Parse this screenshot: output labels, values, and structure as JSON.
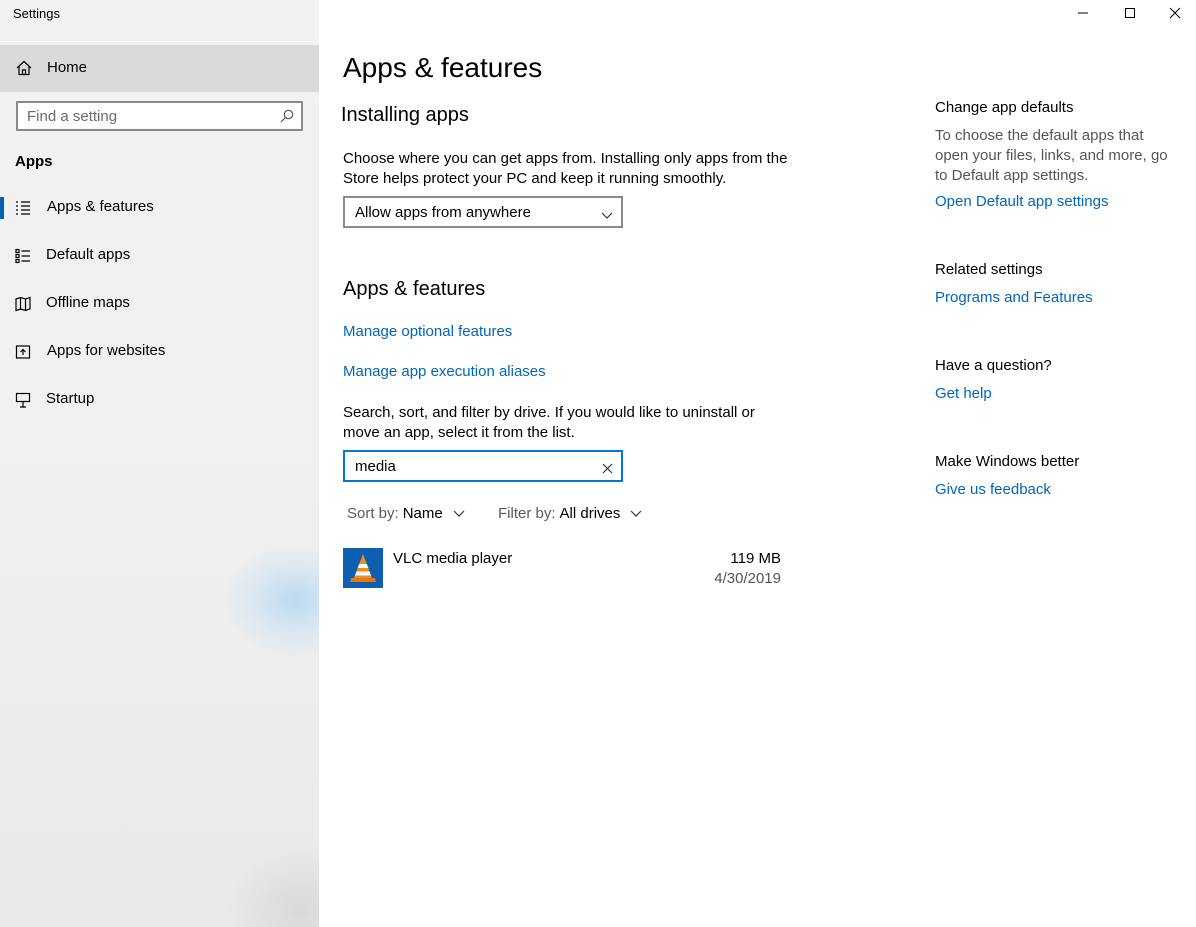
{
  "window": {
    "title": "Settings",
    "controls": {
      "minimize": "minimize",
      "maximize": "maximize",
      "close": "close"
    }
  },
  "sidebar": {
    "home_label": "Home",
    "search_placeholder": "Find a setting",
    "section_label": "Apps",
    "items": [
      {
        "label": "Apps & features",
        "icon": "list-icon",
        "selected": true
      },
      {
        "label": "Default apps",
        "icon": "default-apps-icon",
        "selected": false
      },
      {
        "label": "Offline maps",
        "icon": "map-icon",
        "selected": false
      },
      {
        "label": "Apps for websites",
        "icon": "open-in-icon",
        "selected": false
      },
      {
        "label": "Startup",
        "icon": "startup-icon",
        "selected": false
      }
    ],
    "accent_color": "#0063b1"
  },
  "main": {
    "page_title": "Apps & features",
    "installing": {
      "heading": "Installing apps",
      "description_line1": "Choose where you can get apps from. Installing only apps from the",
      "description_line2": "Store helps protect your PC and keep it running smoothly.",
      "dropdown_value": "Allow apps from anywhere"
    },
    "apps_features": {
      "heading": "Apps & features",
      "link_optional": "Manage optional features",
      "link_aliases": "Manage app execution aliases",
      "search_desc_line1": "Search, sort, and filter by drive. If you would like to uninstall or",
      "search_desc_line2": "move an app, select it from the list.",
      "search_value": "media",
      "sort_key": "Sort by:",
      "sort_value": "Name",
      "filter_key": "Filter by:",
      "filter_value": "All drives",
      "apps": [
        {
          "name": "VLC media player",
          "size": "119 MB",
          "date": "4/30/2019",
          "icon": "vlc-cone-icon"
        }
      ]
    }
  },
  "right": {
    "defaults_heading": "Change app defaults",
    "defaults_desc_line1": "To choose the default apps that",
    "defaults_desc_line2": "open your files, links, and more, go",
    "defaults_desc_line3": "to Default app settings.",
    "defaults_link": "Open Default app settings",
    "related_heading": "Related settings",
    "related_link": "Programs and Features",
    "question_heading": "Have a question?",
    "question_link": "Get help",
    "better_heading": "Make Windows better",
    "better_link": "Give us feedback"
  },
  "colors": {
    "link": "#0067b8",
    "focus": "#0078d7"
  }
}
